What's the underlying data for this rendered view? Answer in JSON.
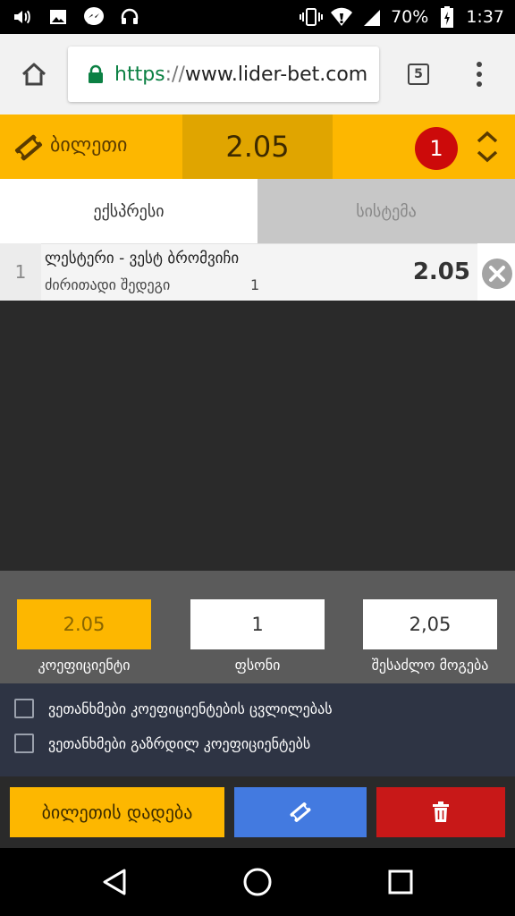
{
  "status_bar": {
    "battery": "70%",
    "time": "1:37",
    "icons": [
      "volume-icon",
      "image-icon",
      "messenger-icon",
      "headset-icon",
      "vibrate-icon",
      "wifi-icon",
      "signal-icon",
      "battery-icon"
    ]
  },
  "browser": {
    "url_scheme": "https",
    "url_sep": "://",
    "url_host": "www.lider-bet.com",
    "tab_count": "5"
  },
  "ticket": {
    "title": "ბილეთი",
    "total_odds": "2.05",
    "bet_count": "1"
  },
  "tabs": [
    {
      "label": "ექსპრესი"
    },
    {
      "label": "სისტემა"
    }
  ],
  "bet": {
    "number": "1",
    "match": "ლესტერი - ვესტ ბრომვიჩი",
    "market": "ძირითადი შედეგი",
    "pick": "1",
    "odds": "2.05"
  },
  "calc": {
    "odds_value": "2.05",
    "odds_label": "კოეფიციენტი",
    "stake_value": "1",
    "stake_label": "ფსონი",
    "win_value": "2,05",
    "win_label": "შესაძლო მოგება"
  },
  "agreements": [
    {
      "label": "ვეთანხმები კოეფიციენტების ცვლილებას"
    },
    {
      "label": "ვეთანხმები გაზრდილ კოეფიციენტებს"
    }
  ],
  "actions": {
    "place_label": "ბილეთის დადება"
  },
  "colors": {
    "accent": "#fdb700",
    "badge": "#cc0a0a",
    "blue": "#437ae0",
    "red": "#c81818"
  }
}
